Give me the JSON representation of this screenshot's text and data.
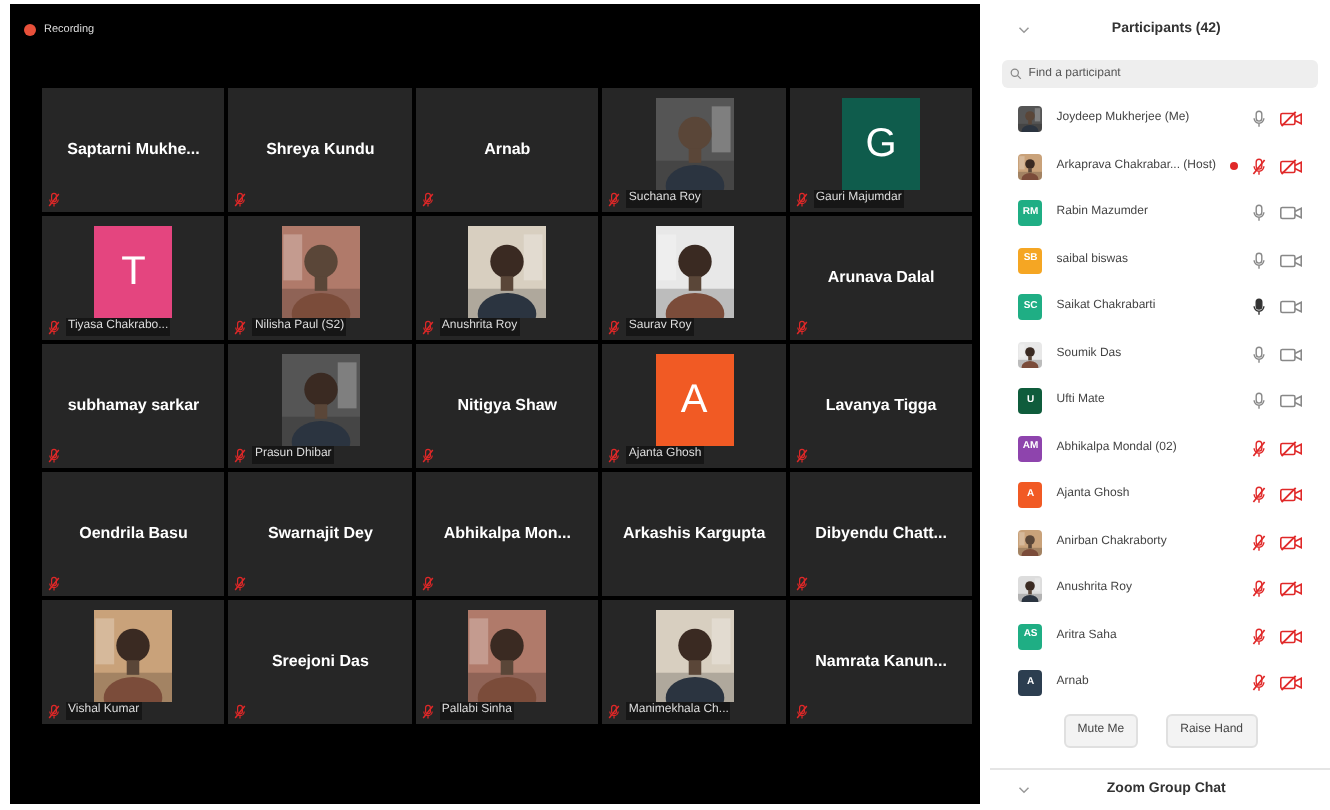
{
  "recording": {
    "label": "Recording"
  },
  "tiles": [
    {
      "kind": "name",
      "name": "Saptarni  Mukhe...",
      "muted": true
    },
    {
      "kind": "name",
      "name": "Shreya Kundu",
      "muted": true
    },
    {
      "kind": "name",
      "name": "Arnab",
      "muted": true
    },
    {
      "kind": "picture",
      "name": "Suchana Roy",
      "muted": true
    },
    {
      "kind": "avatar",
      "letter": "G",
      "color": "#0f5c4c",
      "name": "Gauri Majumdar",
      "muted": true
    },
    {
      "kind": "avatar",
      "letter": "T",
      "color": "#e4457f",
      "name": "Tiyasa Chakrabo...",
      "muted": true
    },
    {
      "kind": "picture",
      "name": "Nilisha Paul (S2)",
      "muted": true
    },
    {
      "kind": "picture",
      "name": "Anushrita Roy",
      "muted": true
    },
    {
      "kind": "picture",
      "name": "Saurav Roy",
      "muted": true
    },
    {
      "kind": "name",
      "name": "Arunava Dalal",
      "muted": true
    },
    {
      "kind": "name",
      "name": "subhamay sarkar",
      "muted": true
    },
    {
      "kind": "picture",
      "name": "Prasun Dhibar",
      "muted": true
    },
    {
      "kind": "name",
      "name": "Nitigya Shaw",
      "muted": true
    },
    {
      "kind": "avatar",
      "letter": "A",
      "color": "#f15a24",
      "name": "Ajanta Ghosh",
      "muted": true
    },
    {
      "kind": "name",
      "name": "Lavanya Tigga",
      "muted": true
    },
    {
      "kind": "name",
      "name": "Oendrila Basu",
      "muted": true
    },
    {
      "kind": "name",
      "name": "Swarnajit Dey",
      "muted": true
    },
    {
      "kind": "name",
      "name": "Abhikalpa  Mon...",
      "muted": true
    },
    {
      "kind": "name",
      "name": "Arkashis Kargupta",
      "muted": false
    },
    {
      "kind": "name",
      "name": "Dibyendu  Chatt...",
      "muted": true
    },
    {
      "kind": "picture",
      "name": "Vishal Kumar",
      "muted": true
    },
    {
      "kind": "name",
      "name": "Sreejoni Das",
      "muted": true
    },
    {
      "kind": "picture",
      "name": "Pallabi Sinha",
      "muted": true
    },
    {
      "kind": "picture",
      "name": "Manimekhala Ch...",
      "muted": true
    },
    {
      "kind": "name",
      "name": "Namrata  Kanun...",
      "muted": true
    }
  ],
  "sidebar": {
    "title": "Participants (42)",
    "search": {
      "placeholder": "Find a participant"
    },
    "participants": [
      {
        "name": "Joydeep Mukherjee (Me)",
        "photo": true,
        "muted": false,
        "speaking": false,
        "video_off": true,
        "recording": false
      },
      {
        "name": "Arkaprava Chakrabar... (Host)",
        "photo": true,
        "muted": true,
        "speaking": false,
        "video_off": true,
        "recording": true
      },
      {
        "name": "Rabin Mazumder",
        "photo": false,
        "initials": "RM",
        "color": "#1fae84",
        "muted": false,
        "speaking": false,
        "video_off": false,
        "recording": false
      },
      {
        "name": "saibal biswas",
        "photo": false,
        "initials": "SB",
        "color": "#f5a623",
        "muted": false,
        "speaking": false,
        "video_off": false,
        "recording": false
      },
      {
        "name": "Saikat Chakrabarti",
        "photo": false,
        "initials": "SC",
        "color": "#1fae84",
        "muted": false,
        "speaking": true,
        "video_off": false,
        "recording": false
      },
      {
        "name": "Soumik Das",
        "photo": true,
        "muted": false,
        "speaking": false,
        "video_off": false,
        "recording": false
      },
      {
        "name": "Ufti Mate",
        "photo": false,
        "initials": "U",
        "color": "#0f5c3c",
        "muted": false,
        "speaking": false,
        "video_off": false,
        "recording": false
      },
      {
        "name": "Abhikalpa Mondal (02)",
        "photo": false,
        "initials": "AM",
        "color": "#8e44ad",
        "muted": true,
        "speaking": false,
        "video_off": true,
        "recording": false
      },
      {
        "name": "Ajanta Ghosh",
        "photo": false,
        "initials": "A",
        "color": "#f15a24",
        "muted": true,
        "speaking": false,
        "video_off": true,
        "recording": false
      },
      {
        "name": "Anirban Chakraborty",
        "photo": true,
        "muted": true,
        "speaking": false,
        "video_off": true,
        "recording": false
      },
      {
        "name": "Anushrita Roy",
        "photo": true,
        "muted": true,
        "speaking": false,
        "video_off": true,
        "recording": false
      },
      {
        "name": "Aritra Saha",
        "photo": false,
        "initials": "AS",
        "color": "#1fae84",
        "muted": true,
        "speaking": false,
        "video_off": true,
        "recording": false
      },
      {
        "name": "Arnab",
        "photo": false,
        "initials": "A",
        "color": "#2c3e50",
        "muted": true,
        "speaking": false,
        "video_off": true,
        "recording": false
      }
    ],
    "buttons": [
      "Mute Me",
      "Raise Hand"
    ],
    "chat": {
      "title": "Zoom Group Chat"
    }
  }
}
